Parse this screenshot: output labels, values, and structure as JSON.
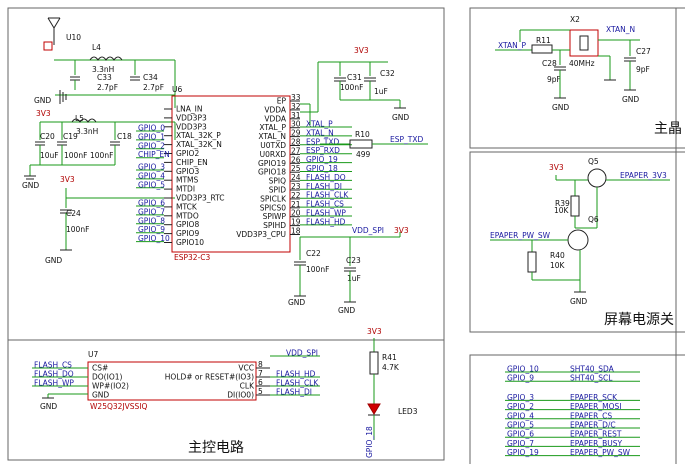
{
  "titles": {
    "main_circuit": "主控电路",
    "screen_power": "屏幕电源关",
    "crystal": "主晶"
  },
  "esp32": {
    "ref": "U6",
    "part": "ESP32-C3",
    "left_pins": [
      "LNA_IN",
      "VDD3P3",
      "VDD3P3",
      "XTAL_32K_P",
      "XTAL_32K_N",
      "GPIO2",
      "CHIP_EN",
      "GPIO3",
      "MTMS",
      "MTDI",
      "VDD3P3_RTC",
      "MTCK",
      "MTDO",
      "GPIO8",
      "GPIO9",
      "GPIO10"
    ],
    "right_pins": [
      "EP",
      "VDDA",
      "VDDA",
      "XTAL_P",
      "XTAL_N",
      "U0TXD",
      "U0RXD",
      "GPIO19",
      "GPIO18",
      "SPIQ",
      "SPID",
      "SPICLK",
      "SPICS0",
      "SPIWP",
      "SPIHD",
      "VDD3P3_CPU"
    ],
    "right_nums": [
      "33",
      "32",
      "31",
      "30",
      "29",
      "28",
      "27",
      "26",
      "25",
      "24",
      "23",
      "22",
      "21",
      "20",
      "19",
      "18"
    ],
    "left_nets": [
      "GPIO_0",
      "GPIO_1",
      "GPIO_2",
      "CHIP_EN",
      "GPIO_3",
      "GPIO_4",
      "GPIO_5",
      "GPIO_6",
      "GPIO_7",
      "GPIO_8",
      "GPIO_9",
      "GPIO_10"
    ],
    "right_nets": [
      "XTAL_P",
      "XTAL_N",
      "ESP_TXD",
      "ESP_RXD",
      "GPIO_19",
      "GPIO_18",
      "FLASH_DO",
      "FLASH_DI",
      "FLASH_CLK",
      "FLASH_CS",
      "FLASH_WP",
      "FLASH_HD"
    ]
  },
  "antenna": {
    "ref": "U10",
    "l4": "L4",
    "l4_val": "3.3nH",
    "c33": "C33",
    "c33_val": "2.7pF",
    "c34": "C34",
    "c34_val": "2.7pF",
    "gnd": "GND"
  },
  "power_in": {
    "net": "3V3",
    "l5": "L5",
    "l5_val": "3.3nH",
    "c20": "C20",
    "c19": "C19",
    "c18": "C18",
    "c20_val": "10uF",
    "c19_val": "100nF",
    "c18_val": "100nF",
    "gnd": "GND"
  },
  "c24": {
    "net": "3V3",
    "ref": "C24",
    "val": "100nF",
    "gnd": "GND"
  },
  "vdda": {
    "net": "3V3",
    "c31": "C31",
    "c31_val": "100nF",
    "c32": "C32",
    "c32_val": "1uF",
    "gnd": "GND"
  },
  "uart": {
    "r10": "R10",
    "r10_val": "499",
    "net": "ESP_TXD"
  },
  "cpu_power": {
    "net": "VDD_SPI",
    "net2": "3V3",
    "c22": "C22",
    "c22_val": "100nF",
    "c23": "C23",
    "c23_val": "1uF",
    "gnd": "GND"
  },
  "flash": {
    "ref": "U7",
    "part": "W25Q32JVSSIQ",
    "left_pins": [
      "CS#",
      "DO(IO1)",
      "WP#(IO2)",
      "GND"
    ],
    "right_pins": [
      "VCC",
      "HOLD# or RESET#(IO3)",
      "CLK",
      "DI(IO0)"
    ],
    "left_nets": [
      "FLASH_CS",
      "FLASH_DO",
      "FLASH_WP"
    ],
    "right_nets": [
      "VDD_SPI",
      "FLASH_HD",
      "FLASH_CLK",
      "FLASH_DI"
    ],
    "nums": [
      "8",
      "7",
      "6",
      "5"
    ],
    "gnd": "GND"
  },
  "led": {
    "net": "3V3",
    "r41": "R41",
    "r41_val": "4.7K",
    "led": "LED3",
    "gpio": "GPIO_18"
  },
  "xtal": {
    "x2": "X2",
    "freq": "40MHz",
    "r11": "R11",
    "c28": "C28",
    "c28_val": "9pF",
    "c27": "C27",
    "c27_val": "9pF",
    "net_p": "XTAN_P",
    "net_n": "XTAN_N",
    "gnd": "GND"
  },
  "epaper_power": {
    "net": "3V3",
    "q5": "Q5",
    "q6": "Q6",
    "r39": "R39",
    "r39_val": "10K",
    "r40": "R40",
    "r40_val": "10K",
    "out": "EPAPER_3V3",
    "sw": "EPAPER_PW_SW",
    "gnd": "GND"
  },
  "gpio_map": {
    "left": [
      "GPIO_10",
      "GPIO_9",
      "GPIO_3",
      "GPIO_2",
      "GPIO_4",
      "GPIO_5",
      "GPIO_6",
      "GPIO_7",
      "GPIO_19"
    ],
    "right": [
      "SHT40_SDA",
      "SHT40_SCL",
      "EPAPER_SCK",
      "EPAPER_MOSI",
      "EPAPER_CS",
      "EPAPER_D/C",
      "EPAPER_REST",
      "EPAPER_BUSY",
      "EPAPER_PW_SW"
    ]
  }
}
